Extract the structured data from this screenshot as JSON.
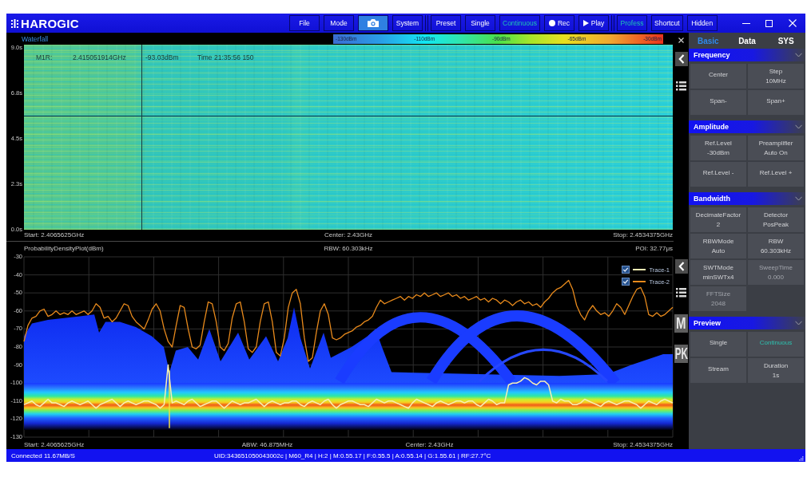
{
  "app_bar": {
    "logo": "HAROGIC",
    "toolbar_groups": [
      [
        {
          "kind": "text",
          "label": "File",
          "selected": false
        },
        {
          "kind": "text",
          "label": "Mode",
          "selected": false
        },
        {
          "kind": "camera",
          "selected": true
        },
        {
          "kind": "text",
          "label": "System",
          "selected": false
        }
      ],
      [
        {
          "kind": "text",
          "label": "Preset",
          "selected": false
        },
        {
          "kind": "text",
          "label": "Single",
          "selected": false
        },
        {
          "kind": "text",
          "label": "Continuous",
          "selected": true
        },
        {
          "kind": "record",
          "label": "Rec",
          "selected": false
        },
        {
          "kind": "play",
          "label": "Play",
          "selected": false
        }
      ],
      [
        {
          "kind": "text",
          "label": "Profess",
          "selected": true
        },
        {
          "kind": "text",
          "label": "Shortcut",
          "selected": false
        },
        {
          "kind": "text",
          "label": "Hidden",
          "selected": false
        }
      ]
    ]
  },
  "waterfall": {
    "title": "Waterfall",
    "color_scale": [
      "-130dBm",
      "-110dBm",
      "-90dBm",
      "-65dBm",
      "-30dBm"
    ],
    "time_ticks": [
      "9.0s",
      "6.8s",
      "4.5s",
      "2.3s",
      "0.0s"
    ],
    "marker": {
      "name": "M1R:",
      "frequency": "2.415051914GHz",
      "power": "-93.03dBm",
      "time": "Time 21:35:56 150"
    },
    "footer": [
      "Start: 2.4065625GHz",
      "Center: 2.43GHz",
      "Stop: 2.4534375GHz"
    ]
  },
  "density": {
    "rbw": "RBW: 60.303kHz",
    "poi": "POI: 32.77μs",
    "legend": [
      {
        "checked": true
      },
      {
        "checked": true
      }
    ],
    "chart_data": {
      "type": "line",
      "title": "ProbabilityDensityPlot(dBm)",
      "ylim": [
        -130,
        -30
      ],
      "yticks": [
        -30,
        -40,
        -50,
        -60,
        -70,
        -80,
        -90,
        -100,
        -110,
        -120,
        -130
      ],
      "grid": true,
      "series": [
        {
          "name": "Trace-1",
          "color": "#f6f0b4",
          "values": [
            -112,
            -111,
            -110,
            -112,
            -113,
            -111,
            -109,
            -111,
            -111,
            -112,
            -113,
            -111,
            -110,
            -111,
            -112,
            -111,
            -110,
            -112,
            -114,
            -112,
            -111,
            -110,
            -109,
            -111,
            -113,
            -111,
            -110,
            -111,
            -112,
            -111,
            -110,
            -110,
            -111,
            -112,
            -114,
            -112,
            -90,
            -111,
            -110,
            -111,
            -112,
            -110,
            -109,
            -111,
            -113,
            -112,
            -111,
            -110,
            -110,
            -112,
            -114,
            -112,
            -110,
            -111,
            -112,
            -111,
            -111,
            -110,
            -109,
            -111,
            -113,
            -111,
            -110,
            -111,
            -112,
            -111,
            -111,
            -110,
            -110,
            -112,
            -113,
            -111,
            -110,
            -111,
            -112,
            -110,
            -109,
            -112,
            -114,
            -112,
            -111,
            -110,
            -110,
            -111,
            -112,
            -112,
            -113,
            -111,
            -109,
            -110,
            -111,
            -110,
            -110,
            -111,
            -112,
            -113,
            -114,
            -111,
            -109,
            -110,
            -111,
            -112,
            -113,
            -111,
            -110,
            -111,
            -112,
            -111,
            -110,
            -110,
            -111,
            -110,
            -110,
            -112,
            -113,
            -111,
            -109,
            -110,
            -112,
            -111,
            -111,
            -101,
            -100,
            -100,
            -99,
            -97,
            -98,
            -100,
            -101,
            -99,
            -99,
            -101,
            -110,
            -111,
            -109,
            -110,
            -110,
            -112,
            -112,
            -111,
            -109,
            -110,
            -111,
            -112,
            -113,
            -111,
            -110,
            -111,
            -112,
            -111,
            -110,
            -110,
            -111,
            -112,
            -114,
            -112,
            -110,
            -111,
            -112,
            -110,
            -109,
            -110,
            -111
          ]
        },
        {
          "name": "Trace-2",
          "color": "#e88a1c",
          "values": [
            -77,
            -68,
            -64,
            -63,
            -60,
            -59,
            -63,
            -62,
            -60,
            -62,
            -61,
            -62,
            -60,
            -62,
            -61,
            -60,
            -62,
            -60,
            -56,
            -58,
            -64,
            -63,
            -66,
            -64,
            -60,
            -56,
            -57,
            -63,
            -66,
            -68,
            -70,
            -65,
            -59,
            -56,
            -60,
            -70,
            -77,
            -80,
            -68,
            -57,
            -58,
            -70,
            -80,
            -81,
            -79,
            -66,
            -55,
            -56,
            -66,
            -80,
            -82,
            -78,
            -64,
            -56,
            -55,
            -66,
            -81,
            -83,
            -80,
            -66,
            -56,
            -55,
            -66,
            -83,
            -85,
            -75,
            -58,
            -50,
            -48,
            -56,
            -75,
            -88,
            -86,
            -72,
            -60,
            -56,
            -62,
            -75,
            -76,
            -75,
            -73,
            -72,
            -71,
            -69,
            -68,
            -66,
            -65,
            -63,
            -58,
            -54,
            -56,
            -55,
            -54,
            -53,
            -52,
            -54,
            -52,
            -53,
            -51,
            -52,
            -50,
            -52,
            -51,
            -50,
            -52,
            -51,
            -50,
            -52,
            -51,
            -53,
            -52,
            -54,
            -53,
            -52,
            -54,
            -53,
            -55,
            -53,
            -54,
            -56,
            -54,
            -55,
            -57,
            -55,
            -54,
            -56,
            -55,
            -57,
            -56,
            -58,
            -55,
            -53,
            -50,
            -48,
            -47,
            -45,
            -43,
            -48,
            -57,
            -62,
            -65,
            -60,
            -57,
            -60,
            -62,
            -61,
            -63,
            -60,
            -56,
            -58,
            -62,
            -57,
            -52,
            -48,
            -47,
            -52,
            -62,
            -63,
            -61,
            -63,
            -62,
            -60,
            -58
          ]
        }
      ]
    },
    "footer": [
      "Start: 2.4065625GHz",
      "ABW: 46.875MHz",
      "Center: 2.43GHz",
      "Stop: 2.4534375GHz"
    ]
  },
  "side_buttons": [
    {
      "label": "M"
    },
    {
      "label": "PK"
    }
  ],
  "right_panel": {
    "tabs": [
      {
        "label": "Basic",
        "selected": true
      },
      {
        "label": "Data",
        "selected": false
      },
      {
        "label": "SYS",
        "selected": false
      }
    ],
    "sections": [
      {
        "title": "Frequency",
        "expanded": true,
        "cells": [
          {
            "label": "Center"
          },
          {
            "label": "Step",
            "value": "10MHz"
          },
          {
            "label": "Span-"
          },
          {
            "label": "Span+"
          }
        ]
      },
      {
        "title": "Amplitude",
        "expanded": true,
        "cells": [
          {
            "label": "Ref.Level",
            "value": "-30dBm"
          },
          {
            "label": "Preamplifier",
            "value": "Auto On"
          },
          {
            "label": "Ref.Level -"
          },
          {
            "label": "Ref.Level +"
          }
        ]
      },
      {
        "title": "Bandwidth",
        "expanded": true,
        "cells": [
          {
            "label": "DecimateFactor",
            "value": "2",
            "disabled": false
          },
          {
            "label": "Detector",
            "value": "PosPeak",
            "disabled": false
          },
          {
            "label": "RBWMode",
            "value": "Auto",
            "disabled": false
          },
          {
            "label": "RBW",
            "value": "60.303kHz",
            "disabled": false
          },
          {
            "label": "SWTMode",
            "value": "minSWTx4",
            "disabled": false
          },
          {
            "label": "SweepTime",
            "value": "0.000",
            "disabled": true
          },
          {
            "label": "FFTSize",
            "value": "2048",
            "disabled": true
          }
        ]
      },
      {
        "title": "Preview",
        "expanded": true,
        "cells": [
          {
            "label": "Single",
            "selected": false
          },
          {
            "label": "Continuous",
            "selected": true
          },
          {
            "label": "Stream",
            "selected": false
          },
          {
            "label": "Duration",
            "value": "1s",
            "selected": false
          }
        ]
      }
    ]
  },
  "status_bar": {
    "connection": "Connected 11.67MB/S",
    "device_info": "UID:343651050043002c | M60_R4 | H:2 | M:0.55.17 | F:0.55.5 | A:0.55.14 | G:1.55.61 | RF:27.7°C"
  }
}
